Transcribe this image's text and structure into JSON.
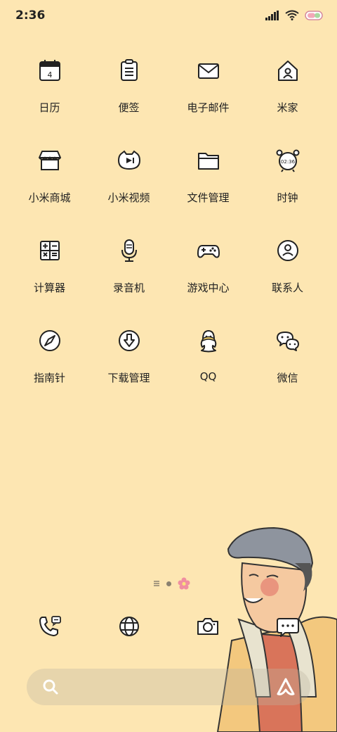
{
  "status_bar": {
    "time": "2:36"
  },
  "apps": [
    {
      "label": "日历",
      "icon": "calendar-icon",
      "day": "4"
    },
    {
      "label": "便签",
      "icon": "notes-icon"
    },
    {
      "label": "电子邮件",
      "icon": "email-icon"
    },
    {
      "label": "米家",
      "icon": "home-icon"
    },
    {
      "label": "小米商城",
      "icon": "store-icon"
    },
    {
      "label": "小米视频",
      "icon": "video-icon"
    },
    {
      "label": "文件管理",
      "icon": "folder-icon"
    },
    {
      "label": "时钟",
      "icon": "clock-icon",
      "clock_text": "02:36"
    },
    {
      "label": "计算器",
      "icon": "calculator-icon"
    },
    {
      "label": "录音机",
      "icon": "microphone-icon"
    },
    {
      "label": "游戏中心",
      "icon": "gamepad-icon"
    },
    {
      "label": "联系人",
      "icon": "contacts-icon"
    },
    {
      "label": "指南针",
      "icon": "compass-icon"
    },
    {
      "label": "下载管理",
      "icon": "download-icon"
    },
    {
      "label": "QQ",
      "icon": "qq-icon"
    },
    {
      "label": "微信",
      "icon": "wechat-icon"
    }
  ],
  "dock": [
    {
      "icon": "phone-icon"
    },
    {
      "icon": "browser-icon"
    },
    {
      "icon": "camera-icon"
    },
    {
      "icon": "messages-icon"
    }
  ],
  "colors": {
    "background": "#fde6b2",
    "accent_flower": "#f08fa0"
  }
}
